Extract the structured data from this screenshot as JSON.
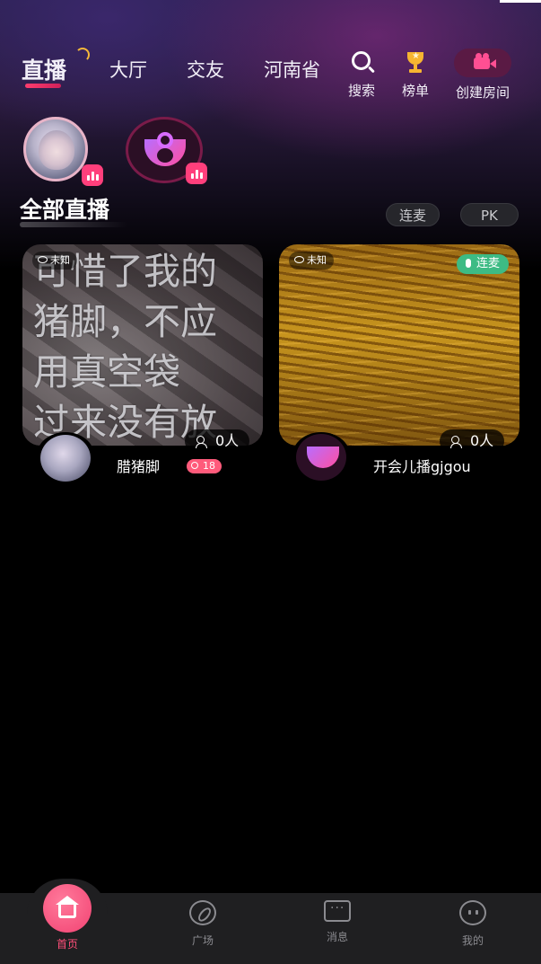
{
  "header": {
    "tabs": [
      {
        "label": "直播",
        "active": true
      },
      {
        "label": "大厅",
        "active": false
      },
      {
        "label": "交友",
        "active": false
      },
      {
        "label": "河南省",
        "active": false
      }
    ],
    "actions": {
      "search_label": "搜索",
      "rank_label": "榜单",
      "create_room_label": "创建房间"
    }
  },
  "section": {
    "title": "全部直播",
    "filters": [
      "连麦",
      "PK"
    ]
  },
  "rooms": [
    {
      "cover_text": [
        "可惜了我的",
        "猪脚，不应",
        "用真空袋",
        "过来没有放"
      ],
      "view_tag": "未知",
      "mic_tag": "",
      "viewers": "0人",
      "host_name": "腊猪脚",
      "level": "18"
    },
    {
      "cover_text": [],
      "view_tag": "未知",
      "mic_tag": "连麦",
      "viewers": "0人",
      "host_name": "开会儿播gjgou",
      "level": ""
    }
  ],
  "bottom_nav": [
    {
      "label": "首页",
      "icon": "home-icon",
      "active": true
    },
    {
      "label": "广场",
      "icon": "compass-icon",
      "active": false
    },
    {
      "label": "消息",
      "icon": "message-icon",
      "active": false
    },
    {
      "label": "我的",
      "icon": "profile-icon",
      "active": false
    }
  ],
  "colors": {
    "accent": "#ff4f79",
    "mic_tag": "#3dbb84",
    "trophy": "#f6b531"
  }
}
